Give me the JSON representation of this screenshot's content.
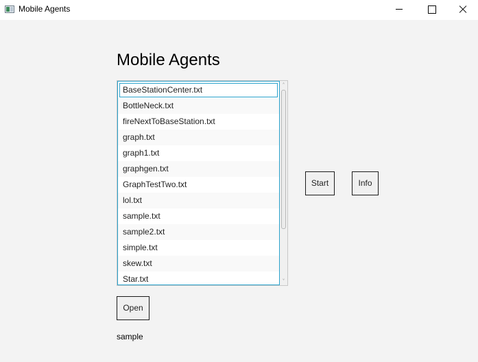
{
  "window": {
    "title": "Mobile Agents",
    "icon": "app-window-icon",
    "controls": {
      "minimize": "minimize-icon",
      "maximize": "maximize-icon",
      "close": "close-icon"
    }
  },
  "main": {
    "heading": "Mobile Agents",
    "file_list": {
      "selected_index": 0,
      "items": [
        "BaseStationCenter.txt",
        "BottleNeck.txt",
        "fireNextToBaseStation.txt",
        "graph.txt",
        "graph1.txt",
        "graphgen.txt",
        "GraphTestTwo.txt",
        "lol.txt",
        "sample.txt",
        "sample2.txt",
        "simple.txt",
        "skew.txt",
        "Star.txt"
      ],
      "scrollbar": {
        "up_glyph": "˄",
        "down_glyph": "˅"
      }
    },
    "buttons": {
      "start": "Start",
      "info": "Info",
      "open": "Open"
    },
    "status_text": "sample"
  },
  "colors": {
    "accent": "#2aa2cc",
    "background": "#f3f3f3",
    "button_bg": "#f0f0f0"
  }
}
